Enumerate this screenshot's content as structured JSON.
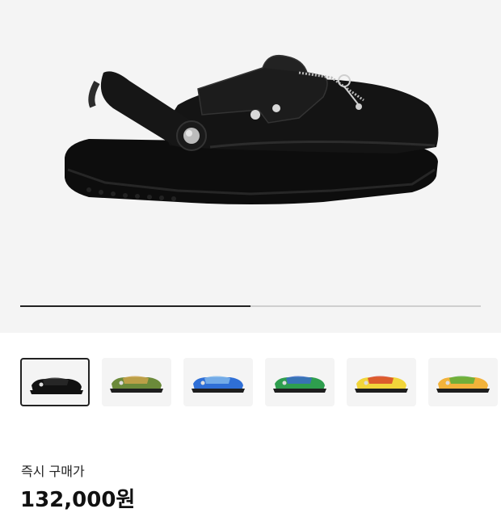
{
  "product": {
    "main_image_icon": "black-leather-clog-icon",
    "image_progress": 0.5
  },
  "thumbnails": [
    {
      "icon": "black-clog-icon",
      "colors": [
        "#111111",
        "#2a2a2a"
      ],
      "selected": true
    },
    {
      "icon": "camo-green-clog-icon",
      "colors": [
        "#6b8a3a",
        "#c9a24a"
      ],
      "selected": false
    },
    {
      "icon": "blue-camo-clog-icon",
      "colors": [
        "#2f6fd6",
        "#7fb6ea"
      ],
      "selected": false
    },
    {
      "icon": "green-tie-dye-clog-icon",
      "colors": [
        "#2e9e4e",
        "#3a6bc8"
      ],
      "selected": false
    },
    {
      "icon": "yellow-clog-icon",
      "colors": [
        "#f1d53a",
        "#d8472a"
      ],
      "selected": false
    },
    {
      "icon": "orange-green-clog-icon",
      "colors": [
        "#f2b23a",
        "#5cae3a"
      ],
      "selected": false
    }
  ],
  "purchase": {
    "label": "즉시 구매가",
    "price": "132,000원"
  }
}
